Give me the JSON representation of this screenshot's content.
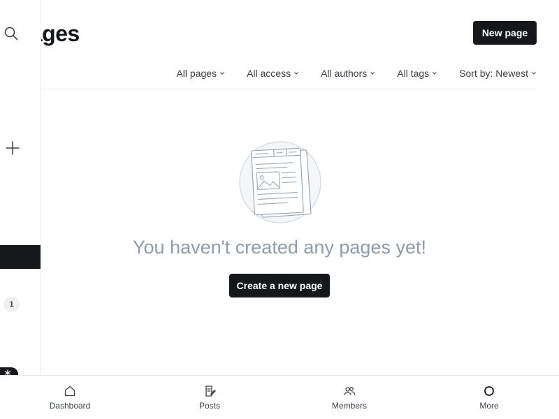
{
  "header": {
    "title": "Pages",
    "new_page_label": "New page"
  },
  "sidebar": {
    "badge_count": "1"
  },
  "filters": [
    {
      "label": "All pages"
    },
    {
      "label": "All access"
    },
    {
      "label": "All authors"
    },
    {
      "label": "All tags"
    },
    {
      "label": "Sort by: Newest"
    }
  ],
  "empty_state": {
    "message": "You haven't created any pages yet!",
    "cta_label": "Create a new page"
  },
  "bottom_nav": [
    {
      "label": "Dashboard",
      "icon": "home-icon"
    },
    {
      "label": "Posts",
      "icon": "posts-icon"
    },
    {
      "label": "Members",
      "icon": "members-icon"
    },
    {
      "label": "More",
      "icon": "more-icon"
    }
  ],
  "colors": {
    "primary": "#15171a",
    "muted_text": "#8e9cac",
    "body_text": "#394047"
  }
}
